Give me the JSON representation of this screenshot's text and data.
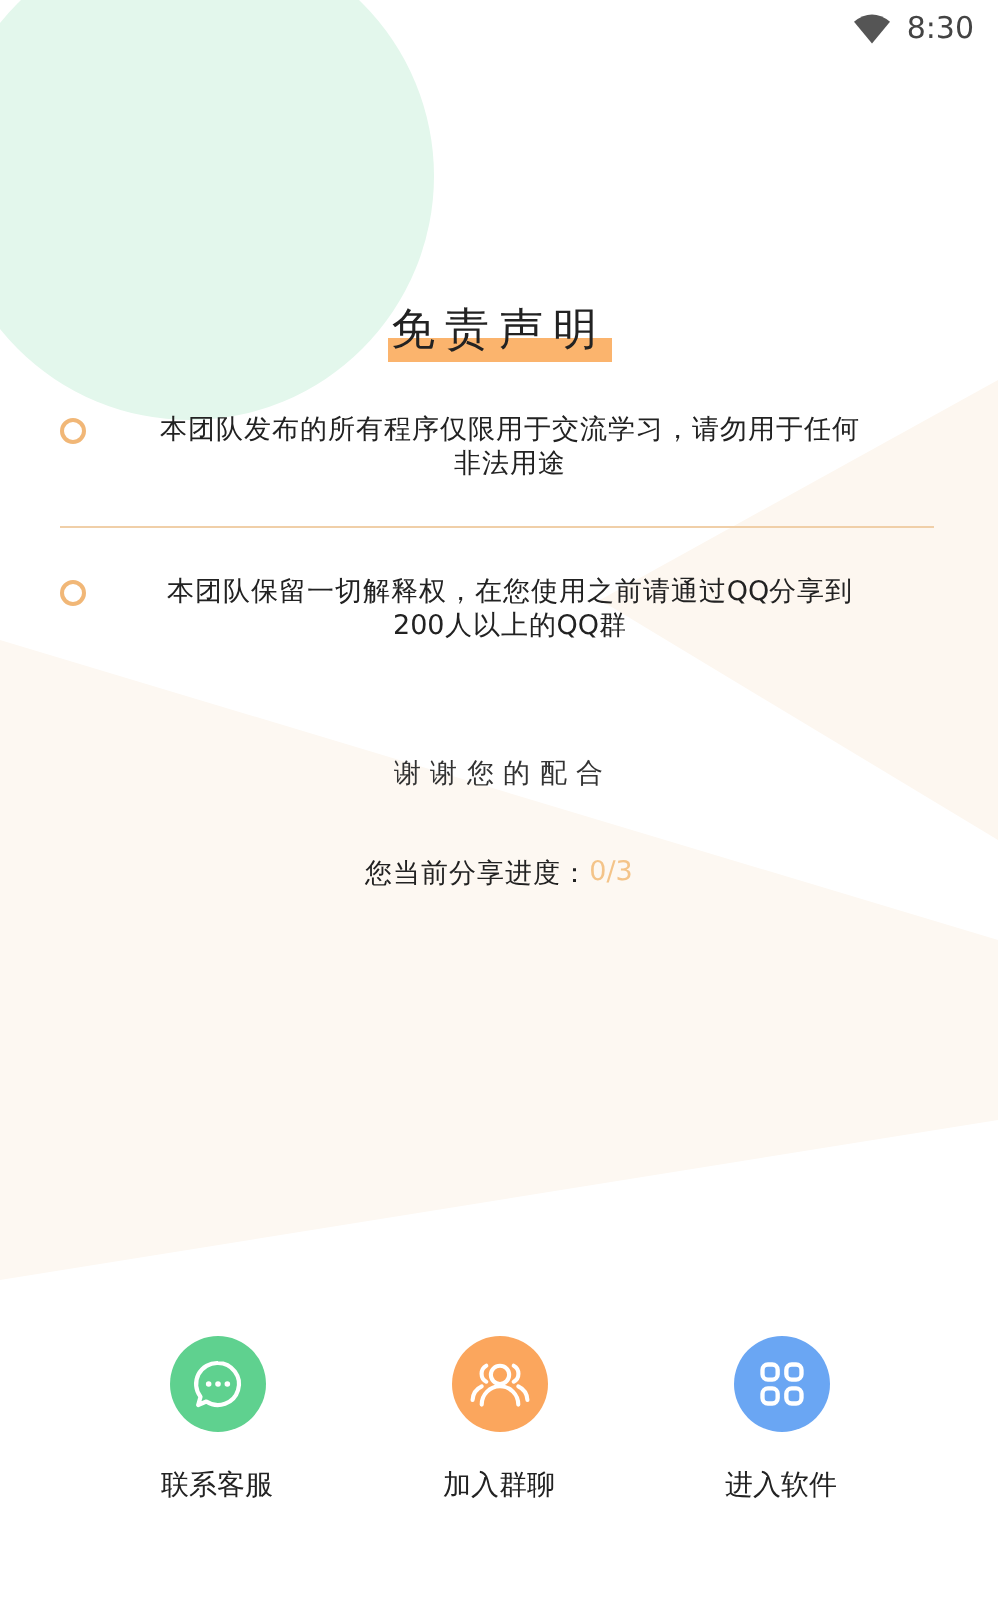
{
  "status_bar": {
    "time": "8:30"
  },
  "title": "免责声明",
  "notices": [
    {
      "text": "本团队发布的所有程序仅限用于交流学习，请勿用于任何非法用途"
    },
    {
      "text": "本团队保留一切解释权，在您使用之前请通过QQ分享到200人以上的QQ群"
    }
  ],
  "thanks": "谢 谢 您 的 配 合",
  "progress": {
    "label": "您当前分享进度：",
    "value": "0/3"
  },
  "actions": [
    {
      "kind": "chat",
      "label": "联系客服",
      "color": "#5fd18f"
    },
    {
      "kind": "group",
      "label": "加入群聊",
      "color": "#fba65d"
    },
    {
      "kind": "apps",
      "label": "进入软件",
      "color": "#6aa6f3"
    }
  ]
}
